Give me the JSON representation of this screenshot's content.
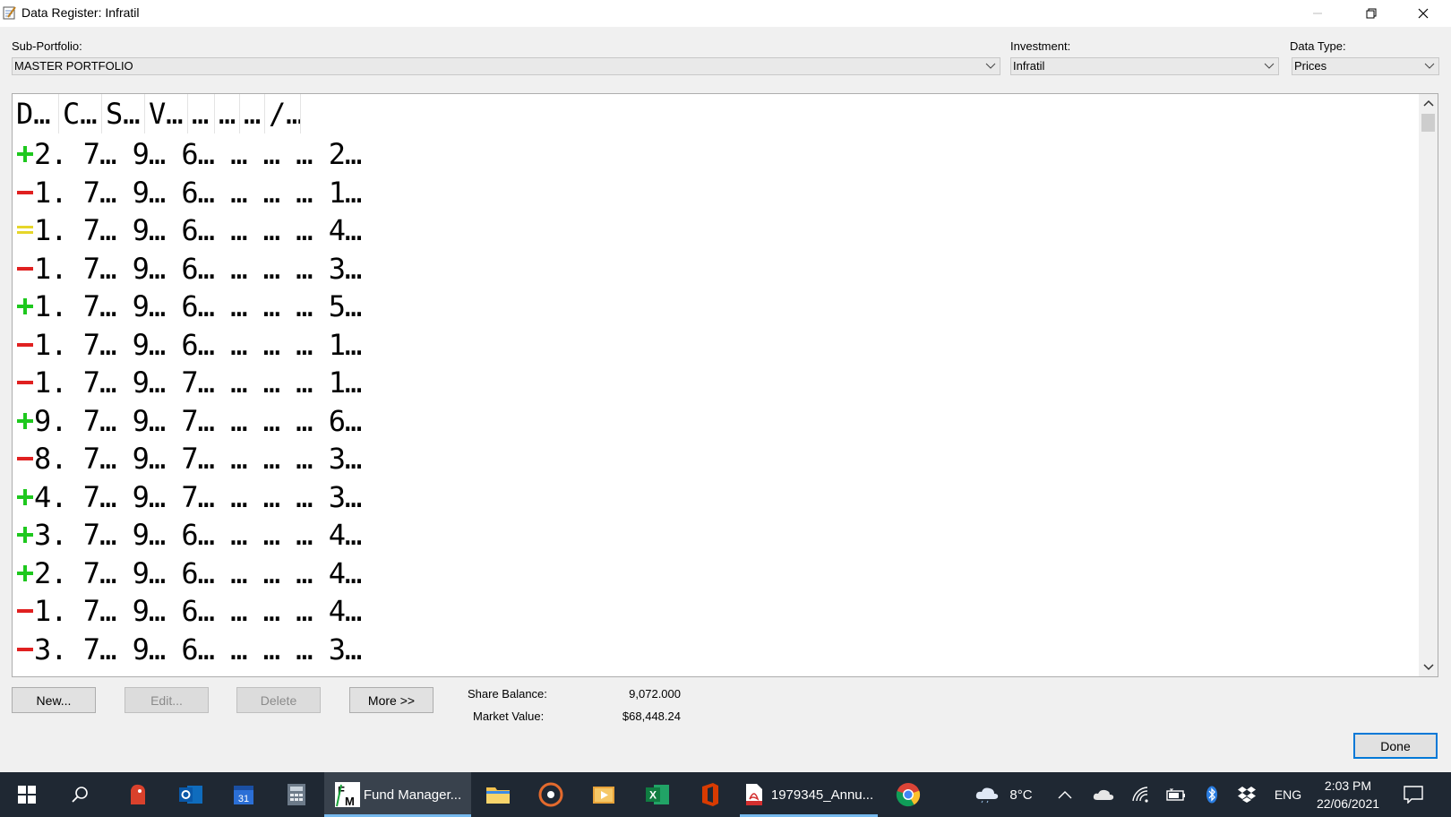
{
  "window": {
    "title": "Data Register: Infratil"
  },
  "filters": {
    "sub_portfolio_label": "Sub-Portfolio:",
    "sub_portfolio_value": "MASTER PORTFOLIO",
    "investment_label": "Investment:",
    "investment_value": "Infratil",
    "data_type_label": "Data Type:",
    "data_type_value": "Prices"
  },
  "grid": {
    "headers": [
      "D…",
      "C…",
      "S…",
      "V…",
      "…",
      "…",
      "…",
      "/…"
    ],
    "rows": [
      {
        "trend": "up",
        "text": "2. 7… 9… 6… … … … 2…"
      },
      {
        "trend": "down",
        "text": "1. 7… 9… 6… … … … 1…"
      },
      {
        "trend": "flat",
        "text": "1. 7… 9… 6… … … … 4…"
      },
      {
        "trend": "down",
        "text": "1. 7… 9… 6… … … … 3…"
      },
      {
        "trend": "up",
        "text": "1. 7… 9… 6… … … … 5…"
      },
      {
        "trend": "down",
        "text": "1. 7… 9… 6… … … … 1…"
      },
      {
        "trend": "down",
        "text": "1. 7… 9… 7… … … … 1…"
      },
      {
        "trend": "up",
        "text": "9. 7… 9… 7… … … … 6…"
      },
      {
        "trend": "down",
        "text": "8. 7… 9… 7… … … … 3…"
      },
      {
        "trend": "up",
        "text": "4. 7… 9… 7… … … … 3…"
      },
      {
        "trend": "up",
        "text": "3. 7… 9… 6… … … … 4…"
      },
      {
        "trend": "up",
        "text": "2. 7… 9… 6… … … … 4…"
      },
      {
        "trend": "down",
        "text": "1. 7… 9… 6… … … … 4…"
      },
      {
        "trend": "down",
        "text": "3. 7… 9… 6… … … … 3…"
      }
    ]
  },
  "actions": {
    "new_label": "New...",
    "edit_label": "Edit...",
    "delete_label": "Delete",
    "more_label": "More >>",
    "done_label": "Done"
  },
  "summary": {
    "share_balance_label": "Share Balance:",
    "share_balance_value": "9,072.000",
    "market_value_label": "Market Value:",
    "market_value_value": "$68,448.24"
  },
  "taskbar": {
    "fund_manager_label": "Fund Manager...",
    "pdf_label": "1979345_Annu...",
    "temperature": "8°C",
    "language": "ENG",
    "time": "2:03 PM",
    "date": "22/06/2021",
    "calendar_day": "31"
  },
  "colors": {
    "up": "#1ec81e",
    "down": "#e02020",
    "flat": "#e6d62a",
    "accent": "#0078d7"
  }
}
